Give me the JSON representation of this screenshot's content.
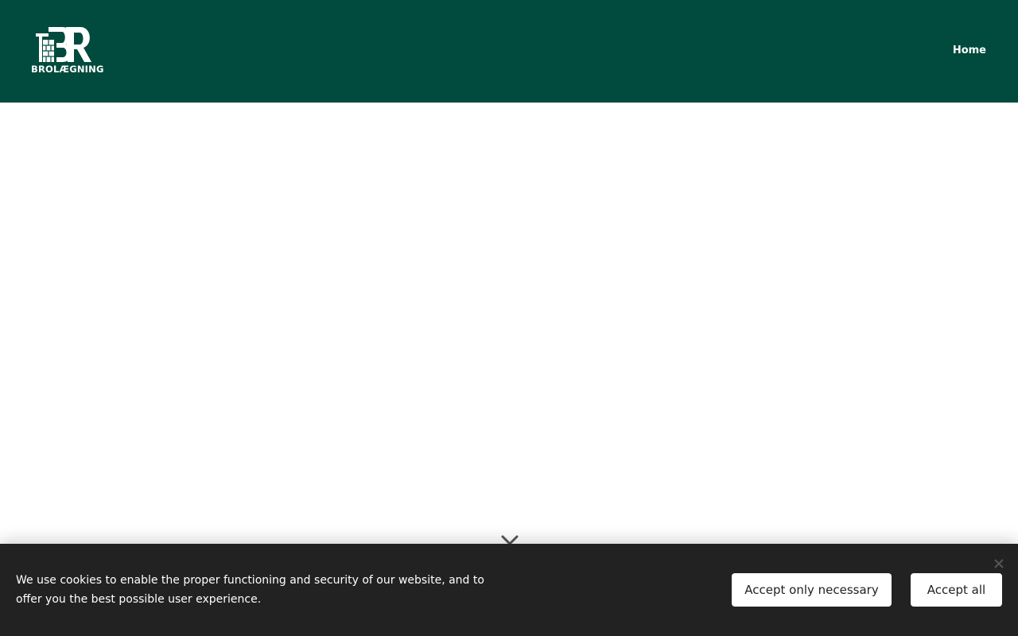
{
  "header": {
    "logo_text": "BROLÆGNING",
    "nav": {
      "home_label": "Home"
    },
    "background_color": "#004b3d"
  },
  "hero": {
    "scroll_icon": "chevron-down-icon"
  },
  "cookie_banner": {
    "message": "We use cookies to enable the proper functioning and security of our website, and to offer you the best possible user experience.",
    "accept_necessary_label": "Accept only necessary",
    "accept_all_label": "Accept all",
    "close_icon": "close-icon",
    "background_color": "#222222"
  }
}
